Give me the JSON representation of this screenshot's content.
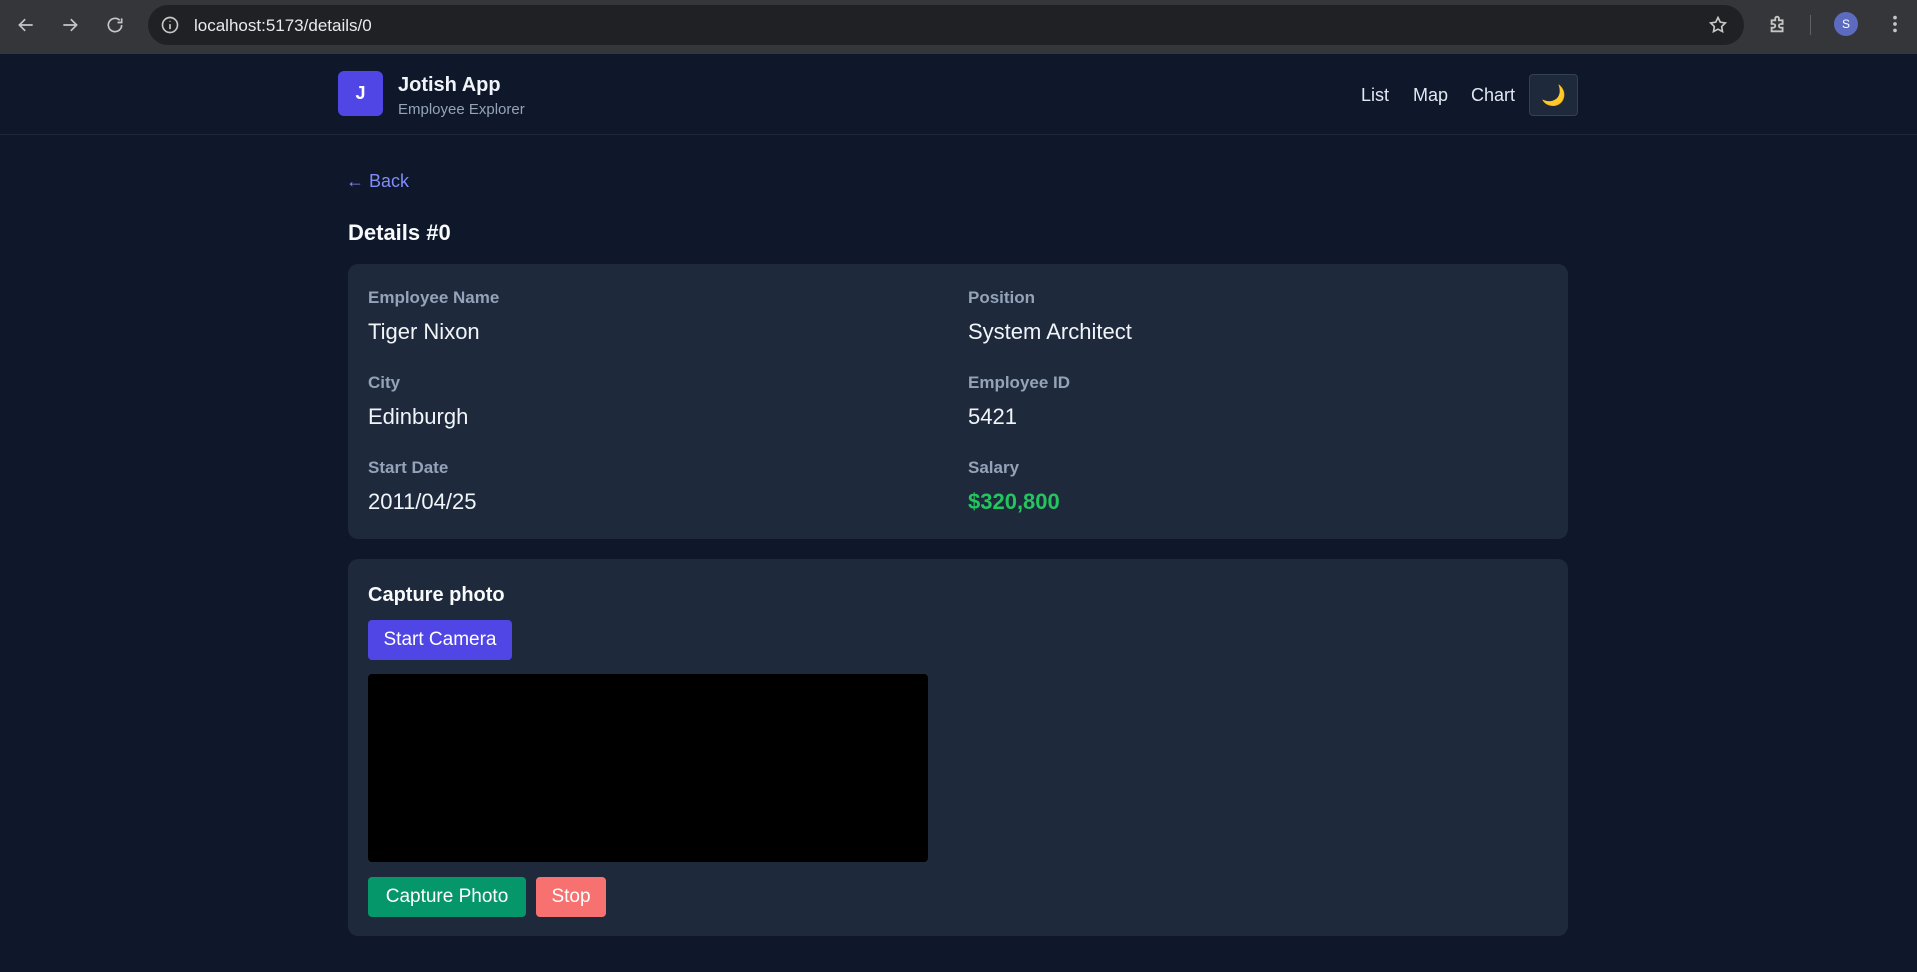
{
  "browser": {
    "url": "localhost:5173/details/0",
    "profile_initial": "S"
  },
  "header": {
    "logo_letter": "J",
    "title": "Jotish App",
    "subtitle": "Employee Explorer",
    "nav": [
      "List",
      "Map",
      "Chart"
    ],
    "theme_toggle": "🌙"
  },
  "page": {
    "back_label": "← Back",
    "title": "Details #0"
  },
  "details": {
    "name_label": "Employee Name",
    "name_value": "Tiger Nixon",
    "position_label": "Position",
    "position_value": "System Architect",
    "city_label": "City",
    "city_value": "Edinburgh",
    "id_label": "Employee ID",
    "id_value": "5421",
    "start_label": "Start Date",
    "start_value": "2011/04/25",
    "salary_label": "Salary",
    "salary_value": "$320,800"
  },
  "capture": {
    "title": "Capture photo",
    "start_label": "Start Camera",
    "capture_label": "Capture Photo",
    "stop_label": "Stop"
  },
  "colors": {
    "accent": "#4f46e5",
    "salary": "#22c55e",
    "capture_button": "#059669",
    "stop_button": "#f87171"
  }
}
